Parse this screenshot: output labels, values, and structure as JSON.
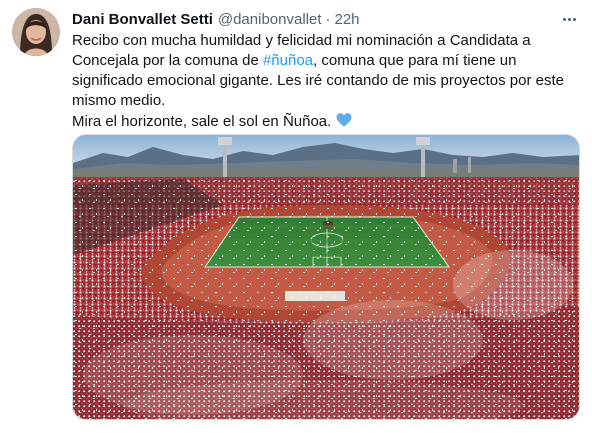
{
  "author": {
    "name": "Dani Bonvallet Setti",
    "handle": "@danibonvallet",
    "separator": "·",
    "time": "22h"
  },
  "tweet": {
    "line1": "Recibo con mucha humildad y felicidad mi nominación a Candidata a",
    "line2_before": "Concejala por la comuna de ",
    "hashtag": "#ñuñoa",
    "line2_after": ", comuna que para mí tiene un",
    "line3": "significado emocional gigante. Les iré contando de mis proyectos por este",
    "line4": "mismo medio.",
    "line5": "Mira el horizonte, sale el sol en Ñuñoa."
  },
  "icons": {
    "more": "more-horizontal-icon",
    "emoji": "blue-heart-emoji"
  },
  "colors": {
    "link": "#1d9bf0",
    "secondary_text": "#536471",
    "heart": "#5dadec"
  }
}
